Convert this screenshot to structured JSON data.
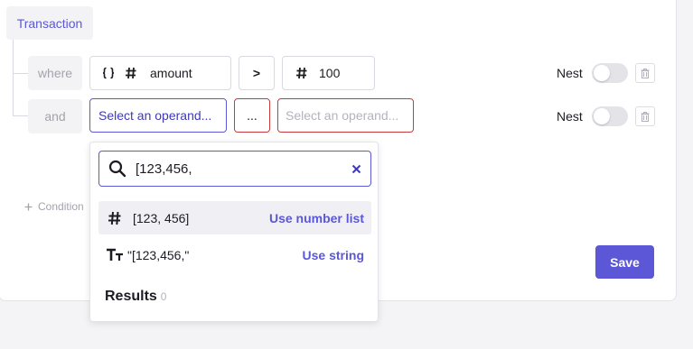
{
  "group": {
    "label": "Transaction"
  },
  "conditions": [
    {
      "keyword": "where",
      "left": {
        "icons": [
          "braces-icon",
          "hash-icon"
        ],
        "value": "amount"
      },
      "operator": ">",
      "right": {
        "icon": "hash-icon",
        "value": "100"
      },
      "nest_label": "Nest",
      "nest_on": false
    },
    {
      "keyword": "and",
      "left": {
        "placeholder": "Select an operand..."
      },
      "operator": "...",
      "right": {
        "placeholder": "Select an operand..."
      },
      "nest_label": "Nest",
      "nest_on": false
    }
  ],
  "add_condition_label": "Condition",
  "save_label": "Save",
  "dropdown": {
    "search_value": "[123,456,",
    "options": [
      {
        "icon": "hash-icon",
        "label": "[123, 456]",
        "action": "Use number list",
        "highlighted": true
      },
      {
        "icon": "text-type-icon",
        "label": "\"[123,456,\"",
        "action": "Use string",
        "highlighted": false
      }
    ],
    "results_label": "Results",
    "results_count": "0"
  },
  "colors": {
    "accent": "#5b57d6",
    "error": "#c93a3a",
    "muted": "#a3a3ad"
  }
}
